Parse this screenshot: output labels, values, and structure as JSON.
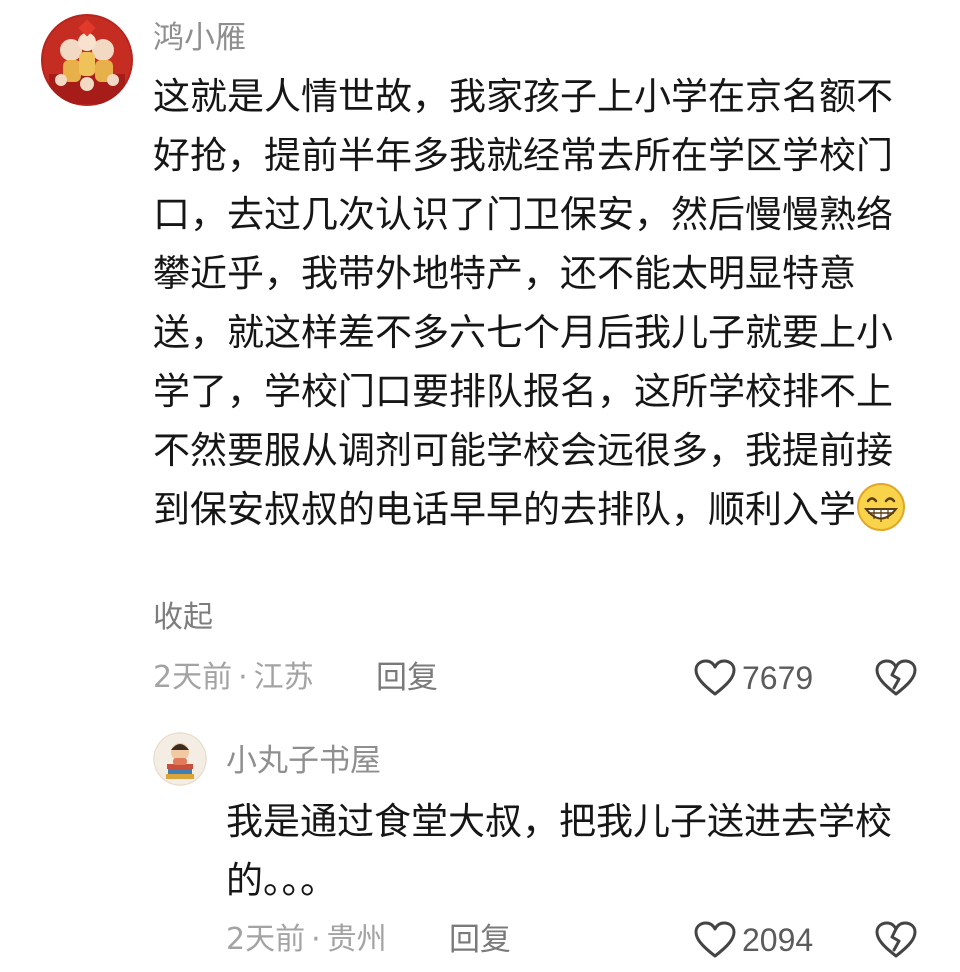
{
  "comments": [
    {
      "username": "鸿小雁",
      "body_lines": [
        "这就是人情世故，我家孩子上小学在京名额不",
        "好抢，提前半年多我就经常去所在学区学校门",
        "口，去过几次认识了门卫保安，然后慢慢熟络",
        "攀近乎，我带外地特产，还不能太明显特意",
        "送，就这样差不多六七个月后我儿子就要上小",
        "学了，学校门口要排队报名，这所学校排不上",
        "不然要服从调剂可能学校会远很多，我提前接",
        "到保安叔叔的电话早早的去排队，顺利入学"
      ],
      "trailing_emoji": "grinning-face-emoji",
      "collapse_label": "收起",
      "time": "2天前",
      "separator": "·",
      "location": "江苏",
      "reply_label": "回复",
      "likes": "7679"
    },
    {
      "username": "小丸子书屋",
      "body_lines": [
        "我是通过食堂大叔，把我儿子送进去学校",
        "的。。。"
      ],
      "time": "2天前",
      "separator": "·",
      "location": "贵州",
      "reply_label": "回复",
      "likes": "2094"
    }
  ],
  "colors": {
    "username": "#8f8f8f",
    "meta": "#a3a3a3",
    "body": "#161616",
    "icon_stroke": "#444444"
  },
  "icons": {
    "like": "heart-outline-icon",
    "dislike": "broken-heart-outline-icon"
  }
}
